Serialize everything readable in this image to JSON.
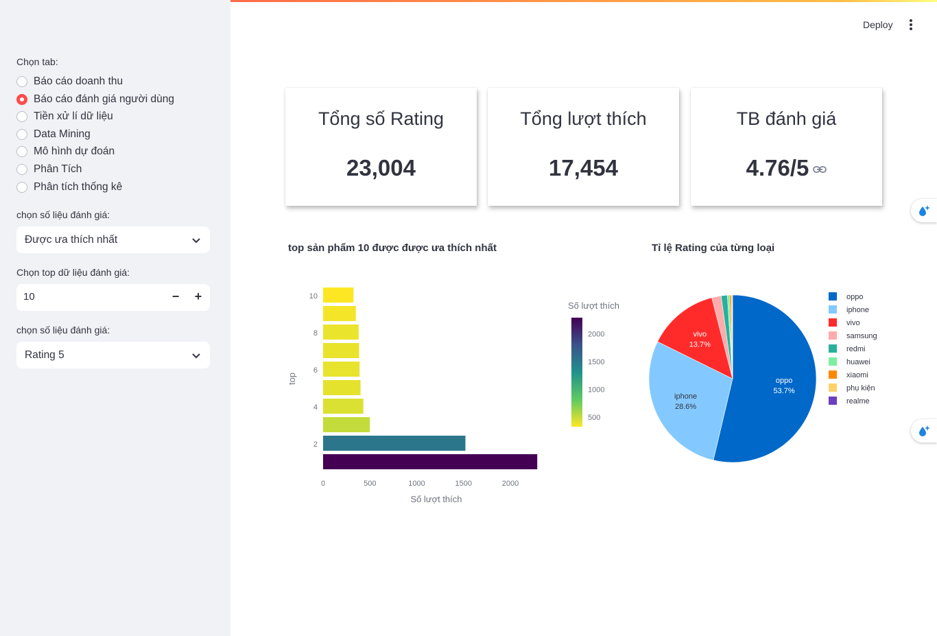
{
  "sidebar": {
    "tab_label": "Chọn tab:",
    "tabs": [
      {
        "label": "Báo cáo doanh thu",
        "selected": false
      },
      {
        "label": "Báo cáo đánh giá người dùng",
        "selected": true
      },
      {
        "label": "Tiền xử lí dữ liệu",
        "selected": false
      },
      {
        "label": "Data Mining",
        "selected": false
      },
      {
        "label": "Mô hình dự đoán",
        "selected": false
      },
      {
        "label": "Phân Tích",
        "selected": false
      },
      {
        "label": "Phân tích thống kê",
        "selected": false
      }
    ],
    "metric_label": "chọn số liệu đánh giá:",
    "metric_value": "Được ưa thích nhất",
    "top_label": "Chọn top dữ liệu đánh giá:",
    "top_value": "10",
    "metric2_label": "chọn số liệu đánh giá:",
    "metric2_value": "Rating 5"
  },
  "header": {
    "deploy_label": "Deploy"
  },
  "cards": [
    {
      "title": "Tổng số Rating",
      "value": "23,004"
    },
    {
      "title": "Tổng lượt thích",
      "value": "17,454"
    },
    {
      "title": "TB đánh giá",
      "value": "4.76/5"
    }
  ],
  "colors": {
    "accent": "#ff4b4b",
    "sidebar_bg": "#f0f2f6"
  },
  "chart_data": [
    {
      "type": "bar",
      "orientation": "horizontal",
      "title": "top sản phẩm 10 được được ưa thích nhất",
      "xlabel": "Số lượt thích",
      "ylabel": "top",
      "colorbar_title": "Số lượt thích",
      "colorscale": "viridis",
      "xlim": [
        0,
        2300
      ],
      "x_ticks": [
        0,
        500,
        1000,
        1500,
        2000
      ],
      "y_ticks": [
        2,
        4,
        6,
        8,
        10
      ],
      "colorbar_ticks": [
        500,
        1000,
        1500,
        2000
      ],
      "categories": [
        1,
        2,
        3,
        4,
        5,
        6,
        7,
        8,
        9,
        10
      ],
      "values": [
        2287,
        1520,
        500,
        430,
        400,
        390,
        385,
        380,
        350,
        325
      ]
    },
    {
      "type": "pie",
      "title": "Tỉ lệ Rating của từng loại",
      "legend_position": "right",
      "slices": [
        {
          "label": "oppo",
          "percent": 53.7,
          "color": "#0068c9",
          "text": "53.7%"
        },
        {
          "label": "iphone",
          "percent": 28.6,
          "color": "#83c9ff",
          "text": "28.6%"
        },
        {
          "label": "vivo",
          "percent": 13.7,
          "color": "#ff2b2b",
          "text": "13.7%"
        },
        {
          "label": "samsung",
          "percent": 1.8,
          "color": "#ffabab",
          "text": ""
        },
        {
          "label": "redmi",
          "percent": 1.2,
          "color": "#29b09d",
          "text": ""
        },
        {
          "label": "huawei",
          "percent": 0.4,
          "color": "#7defa1",
          "text": ""
        },
        {
          "label": "xiaomi",
          "percent": 0.3,
          "color": "#ff8700",
          "text": ""
        },
        {
          "label": "phụ kiện",
          "percent": 0.2,
          "color": "#ffd16a",
          "text": ""
        },
        {
          "label": "realme",
          "percent": 0.1,
          "color": "#6d3fc0",
          "text": ""
        }
      ]
    }
  ]
}
